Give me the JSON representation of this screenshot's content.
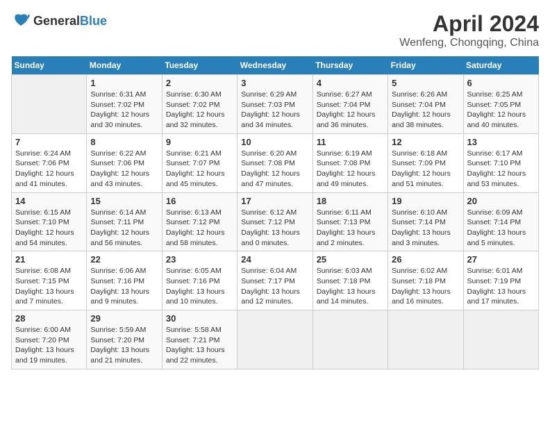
{
  "header": {
    "logo_general": "General",
    "logo_blue": "Blue",
    "month_title": "April 2024",
    "location": "Wenfeng, Chongqing, China"
  },
  "weekdays": [
    "Sunday",
    "Monday",
    "Tuesday",
    "Wednesday",
    "Thursday",
    "Friday",
    "Saturday"
  ],
  "weeks": [
    [
      {
        "day": "",
        "sunrise": "",
        "sunset": "",
        "daylight": ""
      },
      {
        "day": "1",
        "sunrise": "6:31 AM",
        "sunset": "7:02 PM",
        "daylight": "12 hours and 30 minutes."
      },
      {
        "day": "2",
        "sunrise": "6:30 AM",
        "sunset": "7:02 PM",
        "daylight": "12 hours and 32 minutes."
      },
      {
        "day": "3",
        "sunrise": "6:29 AM",
        "sunset": "7:03 PM",
        "daylight": "12 hours and 34 minutes."
      },
      {
        "day": "4",
        "sunrise": "6:27 AM",
        "sunset": "7:04 PM",
        "daylight": "12 hours and 36 minutes."
      },
      {
        "day": "5",
        "sunrise": "6:26 AM",
        "sunset": "7:04 PM",
        "daylight": "12 hours and 38 minutes."
      },
      {
        "day": "6",
        "sunrise": "6:25 AM",
        "sunset": "7:05 PM",
        "daylight": "12 hours and 40 minutes."
      }
    ],
    [
      {
        "day": "7",
        "sunrise": "6:24 AM",
        "sunset": "7:06 PM",
        "daylight": "12 hours and 41 minutes."
      },
      {
        "day": "8",
        "sunrise": "6:22 AM",
        "sunset": "7:06 PM",
        "daylight": "12 hours and 43 minutes."
      },
      {
        "day": "9",
        "sunrise": "6:21 AM",
        "sunset": "7:07 PM",
        "daylight": "12 hours and 45 minutes."
      },
      {
        "day": "10",
        "sunrise": "6:20 AM",
        "sunset": "7:08 PM",
        "daylight": "12 hours and 47 minutes."
      },
      {
        "day": "11",
        "sunrise": "6:19 AM",
        "sunset": "7:08 PM",
        "daylight": "12 hours and 49 minutes."
      },
      {
        "day": "12",
        "sunrise": "6:18 AM",
        "sunset": "7:09 PM",
        "daylight": "12 hours and 51 minutes."
      },
      {
        "day": "13",
        "sunrise": "6:17 AM",
        "sunset": "7:10 PM",
        "daylight": "12 hours and 53 minutes."
      }
    ],
    [
      {
        "day": "14",
        "sunrise": "6:15 AM",
        "sunset": "7:10 PM",
        "daylight": "12 hours and 54 minutes."
      },
      {
        "day": "15",
        "sunrise": "6:14 AM",
        "sunset": "7:11 PM",
        "daylight": "12 hours and 56 minutes."
      },
      {
        "day": "16",
        "sunrise": "6:13 AM",
        "sunset": "7:12 PM",
        "daylight": "12 hours and 58 minutes."
      },
      {
        "day": "17",
        "sunrise": "6:12 AM",
        "sunset": "7:12 PM",
        "daylight": "13 hours and 0 minutes."
      },
      {
        "day": "18",
        "sunrise": "6:11 AM",
        "sunset": "7:13 PM",
        "daylight": "13 hours and 2 minutes."
      },
      {
        "day": "19",
        "sunrise": "6:10 AM",
        "sunset": "7:14 PM",
        "daylight": "13 hours and 3 minutes."
      },
      {
        "day": "20",
        "sunrise": "6:09 AM",
        "sunset": "7:14 PM",
        "daylight": "13 hours and 5 minutes."
      }
    ],
    [
      {
        "day": "21",
        "sunrise": "6:08 AM",
        "sunset": "7:15 PM",
        "daylight": "13 hours and 7 minutes."
      },
      {
        "day": "22",
        "sunrise": "6:06 AM",
        "sunset": "7:16 PM",
        "daylight": "13 hours and 9 minutes."
      },
      {
        "day": "23",
        "sunrise": "6:05 AM",
        "sunset": "7:16 PM",
        "daylight": "13 hours and 10 minutes."
      },
      {
        "day": "24",
        "sunrise": "6:04 AM",
        "sunset": "7:17 PM",
        "daylight": "13 hours and 12 minutes."
      },
      {
        "day": "25",
        "sunrise": "6:03 AM",
        "sunset": "7:18 PM",
        "daylight": "13 hours and 14 minutes."
      },
      {
        "day": "26",
        "sunrise": "6:02 AM",
        "sunset": "7:18 PM",
        "daylight": "13 hours and 16 minutes."
      },
      {
        "day": "27",
        "sunrise": "6:01 AM",
        "sunset": "7:19 PM",
        "daylight": "13 hours and 17 minutes."
      }
    ],
    [
      {
        "day": "28",
        "sunrise": "6:00 AM",
        "sunset": "7:20 PM",
        "daylight": "13 hours and 19 minutes."
      },
      {
        "day": "29",
        "sunrise": "5:59 AM",
        "sunset": "7:20 PM",
        "daylight": "13 hours and 21 minutes."
      },
      {
        "day": "30",
        "sunrise": "5:58 AM",
        "sunset": "7:21 PM",
        "daylight": "13 hours and 22 minutes."
      },
      {
        "day": "",
        "sunrise": "",
        "sunset": "",
        "daylight": ""
      },
      {
        "day": "",
        "sunrise": "",
        "sunset": "",
        "daylight": ""
      },
      {
        "day": "",
        "sunrise": "",
        "sunset": "",
        "daylight": ""
      },
      {
        "day": "",
        "sunrise": "",
        "sunset": "",
        "daylight": ""
      }
    ]
  ]
}
